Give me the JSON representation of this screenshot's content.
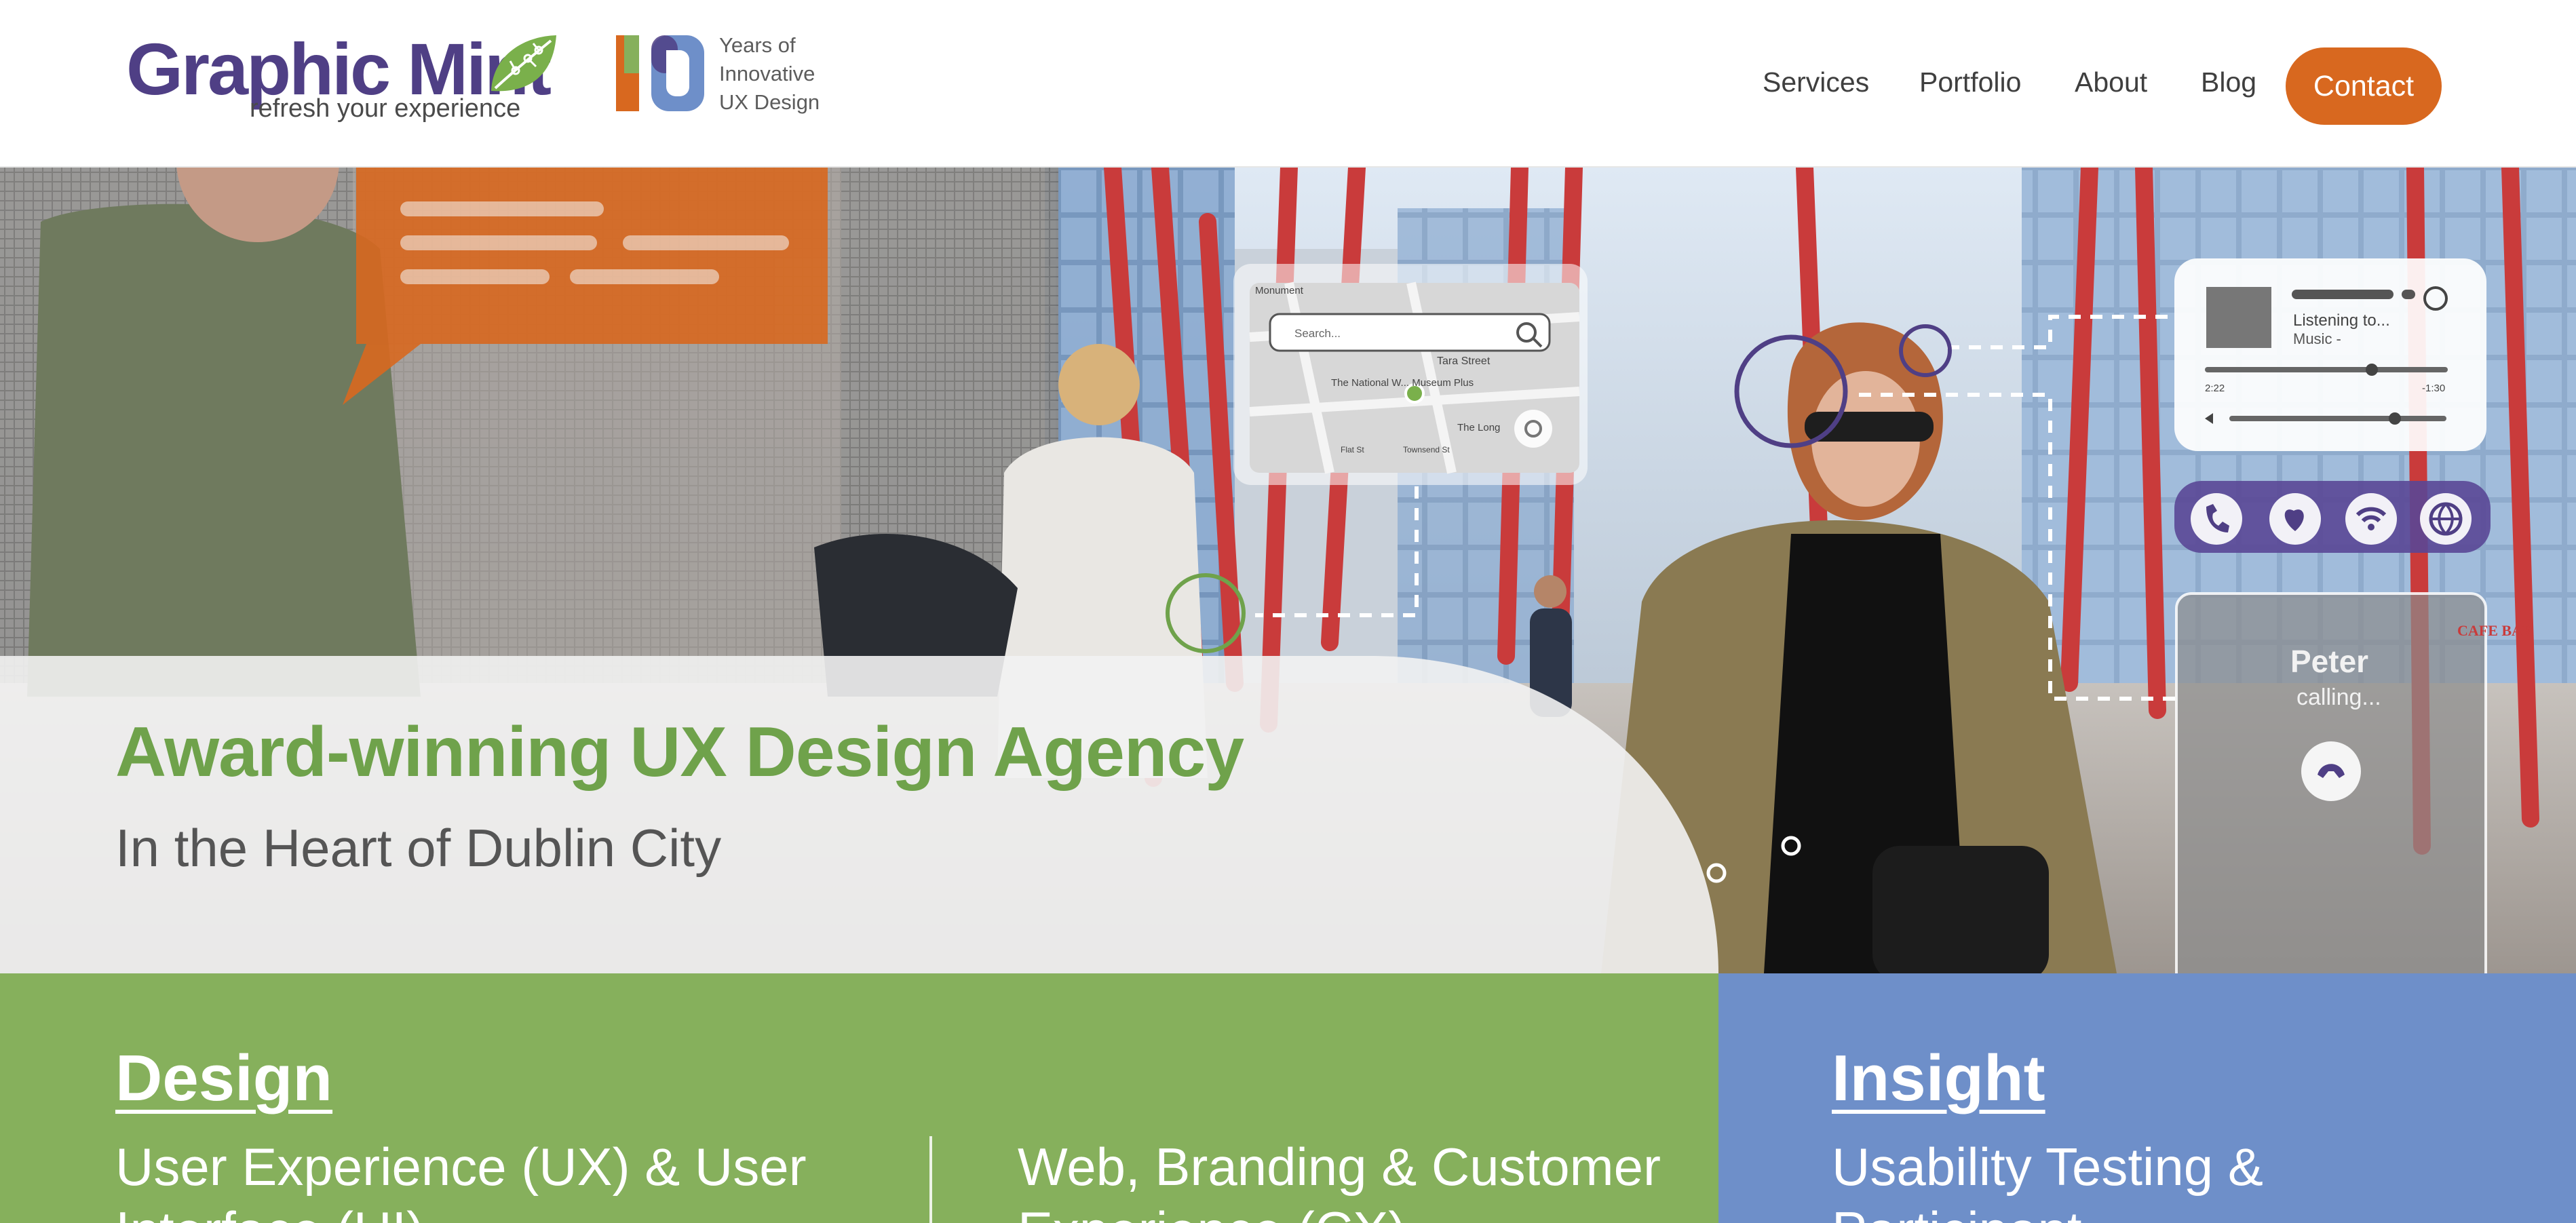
{
  "header": {
    "logo": {
      "name": "Graphic Mint",
      "registered": "®",
      "tagline": "refresh your experience"
    },
    "anniversary": {
      "number": "10",
      "lines": [
        "Years of",
        "Innovative",
        "UX Design"
      ]
    },
    "nav": [
      {
        "label": "Services"
      },
      {
        "label": "Portfolio"
      },
      {
        "label": "About"
      },
      {
        "label": "Blog"
      }
    ],
    "contact_label": "Contact"
  },
  "hero": {
    "title": "Award-winning UX Design Agency",
    "subtitle": "In the Heart of Dublin City",
    "map_card": {
      "search_placeholder": "Search...",
      "labels": [
        "Monument",
        "Tara Street",
        "The National W... Museum Plus",
        "The Long",
        "Flat St",
        "Townsend St"
      ]
    },
    "music_card": {
      "listening": "Listening to...",
      "track": "Music -",
      "elapsed": "2:22",
      "remaining": "-1:30"
    },
    "call_card": {
      "name": "Peter",
      "status": "calling...",
      "sign": "CAFE BAR"
    },
    "colors": {
      "green": "#6fa24b",
      "orange": "#d8681f",
      "purple": "#4f3f85",
      "blue": "#6e8fc9"
    }
  },
  "panels": {
    "design": {
      "heading": "Design",
      "col1": [
        "User Experience (UX) & User",
        "Interface (UI)"
      ],
      "col2": [
        "Web, Branding & Customer",
        "Experience (CX)"
      ]
    },
    "insight": {
      "heading": "Insight",
      "col1": [
        "Usability Testing &",
        "Participant"
      ]
    }
  }
}
